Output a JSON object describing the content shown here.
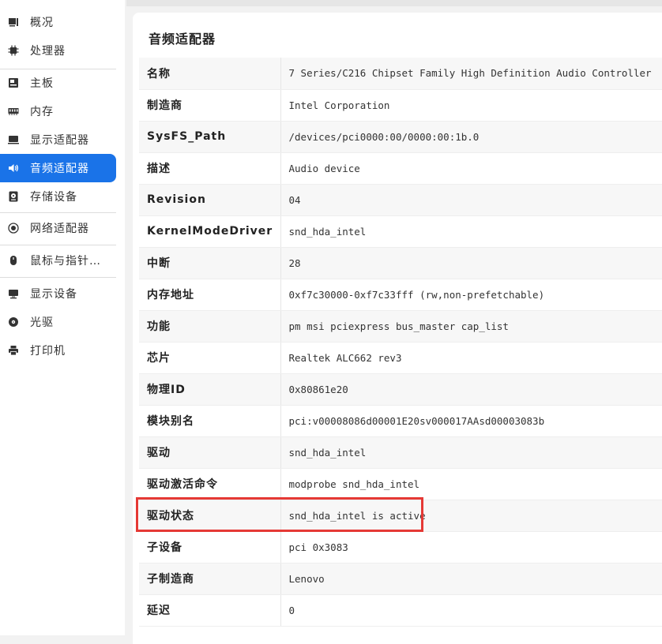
{
  "sidebar": {
    "items": [
      {
        "label": "概况",
        "icon": "overview-icon"
      },
      {
        "label": "处理器",
        "icon": "cpu-icon"
      },
      {
        "label": "主板",
        "icon": "motherboard-icon"
      },
      {
        "label": "内存",
        "icon": "memory-icon"
      },
      {
        "label": "显示适配器",
        "icon": "display-adapter-icon"
      },
      {
        "label": "音频适配器",
        "icon": "speaker-icon",
        "active": true
      },
      {
        "label": "存储设备",
        "icon": "storage-icon"
      },
      {
        "label": "网络适配器",
        "icon": "network-icon"
      },
      {
        "label": "鼠标与指针…",
        "icon": "mouse-icon"
      },
      {
        "label": "显示设备",
        "icon": "monitor-icon"
      },
      {
        "label": "光驱",
        "icon": "optical-drive-icon"
      },
      {
        "label": "打印机",
        "icon": "printer-icon"
      }
    ]
  },
  "panel": {
    "title": "音频适配器",
    "rows": [
      {
        "key": "名称",
        "value": "7 Series/C216 Chipset Family High Definition Audio Controller"
      },
      {
        "key": "制造商",
        "value": "Intel Corporation"
      },
      {
        "key": "SysFS_Path",
        "value": "/devices/pci0000:00/0000:00:1b.0"
      },
      {
        "key": "描述",
        "value": "Audio device"
      },
      {
        "key": "Revision",
        "value": "04"
      },
      {
        "key": "KernelModeDriver",
        "value": "snd_hda_intel"
      },
      {
        "key": "中断",
        "value": "28"
      },
      {
        "key": "内存地址",
        "value": "0xf7c30000-0xf7c33fff (rw,non-prefetchable)"
      },
      {
        "key": "功能",
        "value": "pm msi pciexpress bus_master cap_list"
      },
      {
        "key": "芯片",
        "value": "Realtek ALC662 rev3"
      },
      {
        "key": "物理ID",
        "value": "0x80861e20"
      },
      {
        "key": "模块别名",
        "value": "pci:v00008086d00001E20sv000017AAsd00003083b"
      },
      {
        "key": "驱动",
        "value": "snd_hda_intel"
      },
      {
        "key": "驱动激活命令",
        "value": "modprobe snd_hda_intel"
      },
      {
        "key": "驱动状态",
        "value": "snd_hda_intel is active"
      },
      {
        "key": "子设备",
        "value": "pci 0x3083"
      },
      {
        "key": "子制造商",
        "value": "Lenovo"
      },
      {
        "key": "延迟",
        "value": "0"
      }
    ]
  },
  "colors": {
    "accent": "#1a73e8",
    "highlight": "#e53935"
  }
}
